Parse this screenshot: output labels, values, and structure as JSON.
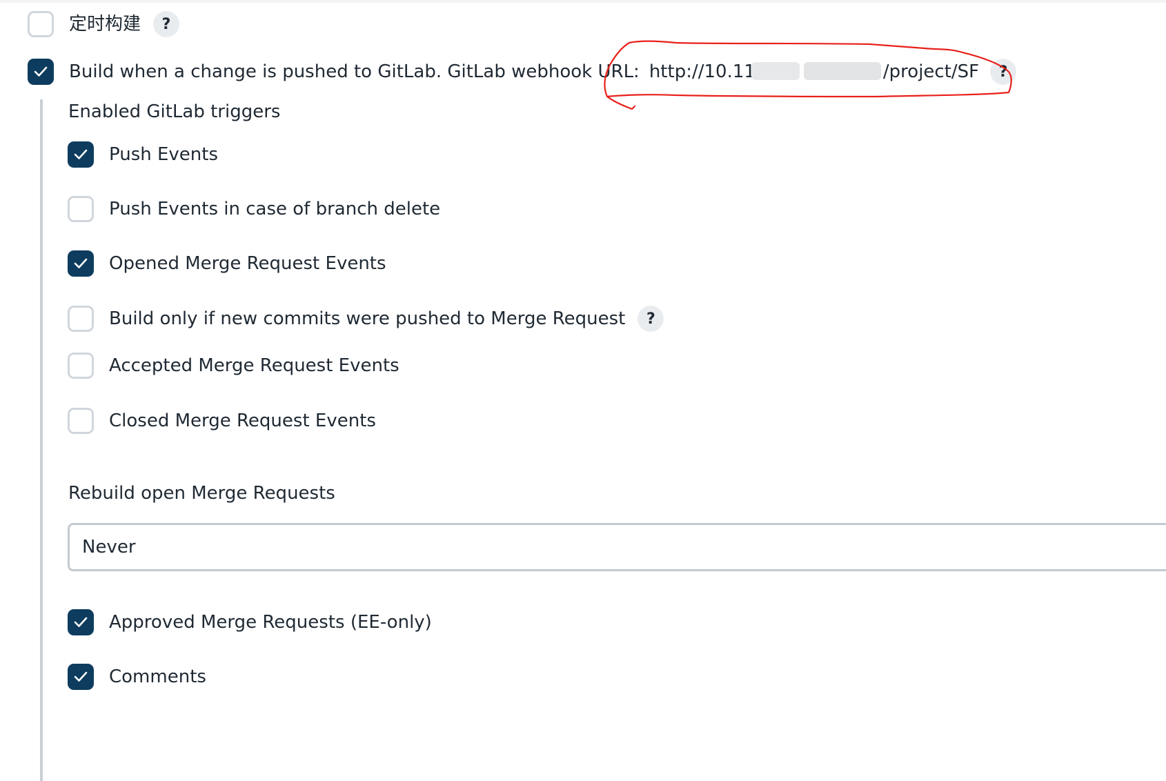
{
  "top_option": {
    "label": "定时构建",
    "checked": false
  },
  "gitlab_option": {
    "label": "Build when a change is pushed to GitLab. GitLab webhook URL:",
    "url_prefix": "http://10.11",
    "url_suffix": "/project/SF",
    "checked": true
  },
  "help_glyph": "?",
  "triggers": {
    "heading": "Enabled GitLab triggers",
    "items": [
      {
        "label": "Push Events",
        "checked": true
      },
      {
        "label": "Push Events in case of branch delete",
        "checked": false
      },
      {
        "label": "Opened Merge Request Events",
        "checked": true
      },
      {
        "label": "Build only if new commits were pushed to Merge Request",
        "checked": false
      },
      {
        "label": "Accepted Merge Request Events",
        "checked": false
      },
      {
        "label": "Closed Merge Request Events",
        "checked": false
      }
    ]
  },
  "rebuild": {
    "heading": "Rebuild open Merge Requests",
    "selected": "Never"
  },
  "more_triggers": [
    {
      "label": "Approved Merge Requests (EE-only)",
      "checked": true
    },
    {
      "label": "Comments",
      "checked": true
    }
  ],
  "colors": {
    "checkbox_checked": "#0d3c5e",
    "checkbox_unchecked_border": "#d0d6dc",
    "annotation_red": "#e8201a",
    "help_bg": "#e9ecef"
  },
  "icons": {
    "checkmark": "checkmark-icon",
    "help": "help-icon"
  }
}
